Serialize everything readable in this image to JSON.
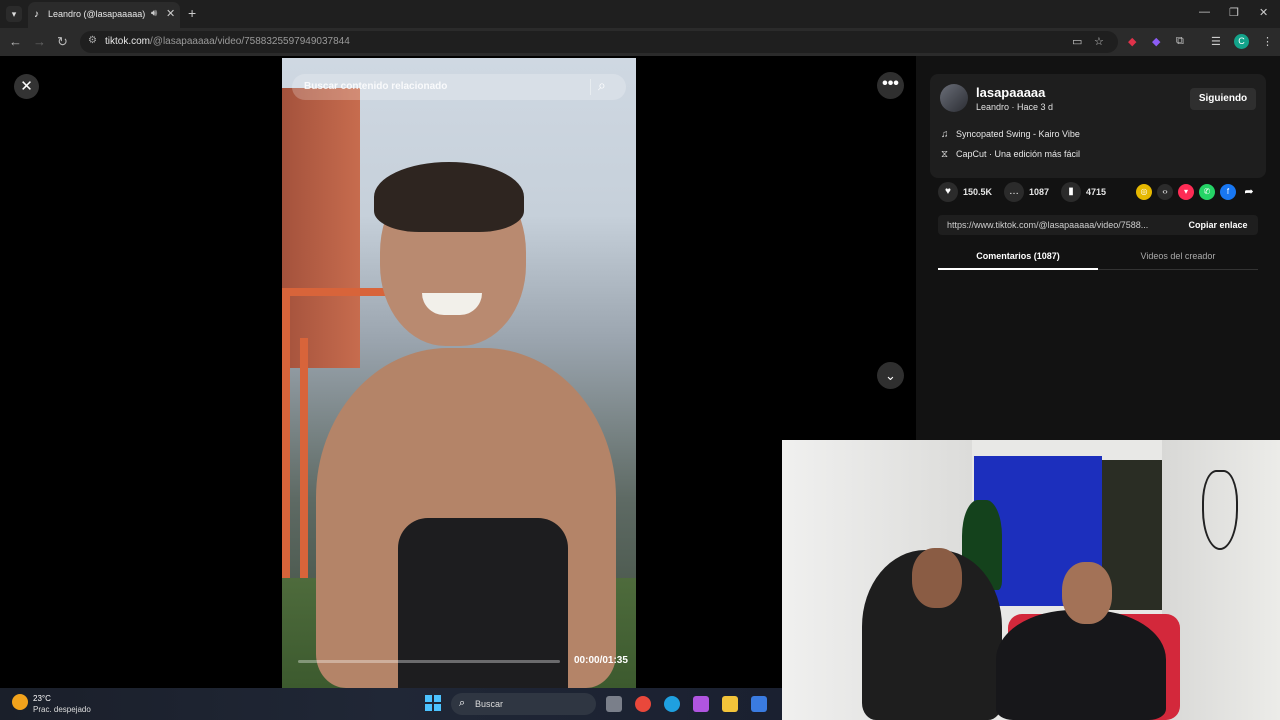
{
  "browser": {
    "tab_title": "Leandro (@lasapaaaaa) | Ti",
    "url_host": "tiktok.com",
    "url_path": "/@lasapaaaaa/video/7588325597949037844"
  },
  "video": {
    "search_placeholder": "Buscar contenido relacionado",
    "time": "00:00/01:35",
    "progress": 0.0
  },
  "creator": {
    "username": "lasapaaaaa",
    "subtitle": "Leandro · Hace 3 d",
    "follow_label": "Siguiendo",
    "music": "Syncopated Swing - Kairo Vibe",
    "capcut": "CapCut · Una edición más fácil"
  },
  "stats": {
    "likes": "150.5K",
    "comments": "1087",
    "saves": "4715"
  },
  "share": {
    "link": "https://www.tiktok.com/@lasapaaaaa/video/7588...",
    "copy_label": "Copiar enlace"
  },
  "tabs": {
    "comments": "Comentarios (1087)",
    "videos": "Videos del creador"
  },
  "taskbar": {
    "temp": "23°C",
    "weather": "Prac. despejado",
    "search_label": "Buscar"
  },
  "colors": {
    "page_bg": "#000000",
    "panel_bg": "#121212",
    "accent_blue": "#4cc2ff"
  }
}
